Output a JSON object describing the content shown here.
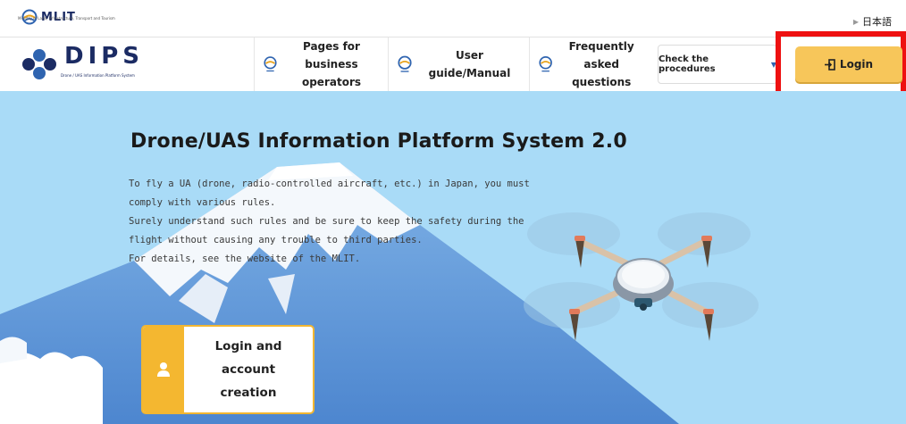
{
  "top": {
    "mlit_logo_text": "MLIT",
    "mlit_sub_text": "Ministry of Land, Infrastructure, Transport and Tourism",
    "language_link": "日本語"
  },
  "nav": {
    "dips_logo_text": "DIPS",
    "dips_sub_text": "Drone / UAS Information Platform System",
    "items": [
      {
        "label_line1": "Pages for business",
        "label_line2": "operators"
      },
      {
        "label_line1": "User guide/Manual",
        "label_line2": ""
      },
      {
        "label_line1": "Frequently",
        "label_line2": "asked questions"
      }
    ],
    "check_procedures": "Check the procedures",
    "login": "Login"
  },
  "hero": {
    "title": "Drone/UAS Information Platform System 2.0",
    "lines": [
      "To fly a UA (drone, radio-controlled aircraft, etc.) in Japan, you must",
      "comply with various rules.",
      "Surely understand such rules and be sure to keep the safety during the",
      "flight without causing any trouble to third parties.",
      "For details, see the website of the MLIT."
    ],
    "card": {
      "line1": "Login and",
      "line2": "account",
      "line3": "creation"
    }
  },
  "colors": {
    "brand_navy": "#1b2b63",
    "accent_yellow": "#f7c65a",
    "highlight_red": "#ee1111",
    "hero_sky": "#a9dbf7"
  },
  "icons": [
    "mlit-logo-icon",
    "dips-logo-icon",
    "globe-icon",
    "login-door-icon",
    "user-icon",
    "drone-illustration"
  ]
}
